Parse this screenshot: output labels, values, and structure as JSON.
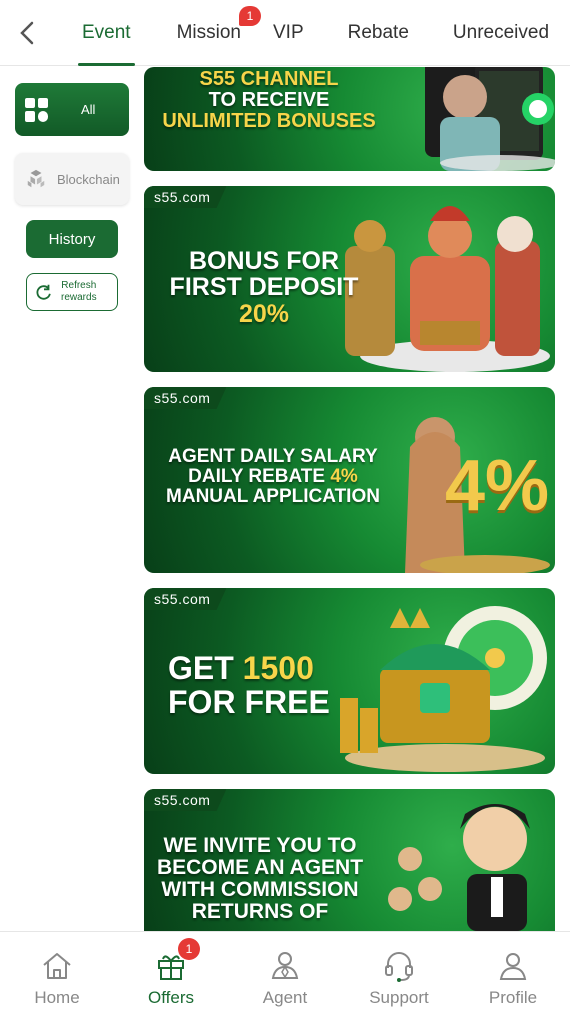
{
  "header": {
    "tabs": [
      {
        "label": "Event",
        "active": true
      },
      {
        "label": "Mission",
        "badge": "1"
      },
      {
        "label": "VIP"
      },
      {
        "label": "Rebate"
      },
      {
        "label": "Unreceived"
      }
    ]
  },
  "sidebar": {
    "all_label": "All",
    "blockchain_label": "Blockchain",
    "history_label": "History",
    "refresh_label_line1": "Refresh",
    "refresh_label_line2": "rewards"
  },
  "banners": [
    {
      "site": "",
      "line1": "S55 CHANNEL",
      "line2": "TO RECEIVE",
      "line3": "UNLIMITED BONUSES"
    },
    {
      "site": "s55.com",
      "line1": "BONUS FOR",
      "line2": "FIRST DEPOSIT",
      "line3": "20%"
    },
    {
      "site": "s55.com",
      "line1": "AGENT DAILY SALARY",
      "line2a": "DAILY REBATE ",
      "line2b": "4%",
      "line3": "MANUAL APPLICATION",
      "big": "4%"
    },
    {
      "site": "s55.com",
      "line1a": "GET ",
      "line1b": "1500",
      "line2": "FOR FREE"
    },
    {
      "site": "s55.com",
      "line1": "WE INVITE YOU TO",
      "line2": "BECOME AN AGENT",
      "line3": "WITH COMMISSION",
      "line4": "RETURNS OF"
    }
  ],
  "bottom_nav": {
    "items": [
      {
        "label": "Home"
      },
      {
        "label": "Offers",
        "badge": "1",
        "active": true
      },
      {
        "label": "Agent"
      },
      {
        "label": "Support"
      },
      {
        "label": "Profile"
      }
    ]
  },
  "colors": {
    "accent": "#1b6b33",
    "badge": "#e53935",
    "highlight": "#f7d54a"
  }
}
